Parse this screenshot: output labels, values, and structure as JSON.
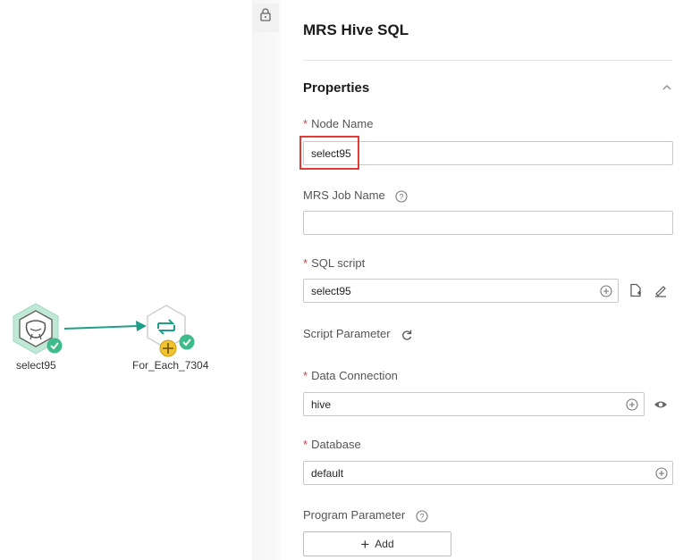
{
  "canvas": {
    "nodes": [
      {
        "label": "select95",
        "icon": "hive-icon",
        "status": "check-icon"
      },
      {
        "label": "For_Each_7304",
        "icon": "loop-icon",
        "status": "check-icon"
      }
    ]
  },
  "panel": {
    "title": "MRS Hive SQL",
    "section_title": "Properties",
    "fields": {
      "node_name": {
        "label": "Node Name",
        "value": "select95"
      },
      "mrs_job_name": {
        "label": "MRS Job Name",
        "value": ""
      },
      "sql_script": {
        "label": "SQL script",
        "value": "select95"
      },
      "script_parameter": {
        "label": "Script Parameter"
      },
      "data_connection": {
        "label": "Data Connection",
        "value": "hive"
      },
      "database": {
        "label": "Database",
        "value": "default"
      },
      "program_parameter": {
        "label": "Program Parameter",
        "add_label": "Add"
      }
    },
    "required_mark": "*"
  },
  "colors": {
    "accent_green": "#3dbb8a",
    "edge_teal": "#1f9e8a",
    "highlight_red": "#e53935",
    "add_yellow": "#f2c230"
  }
}
